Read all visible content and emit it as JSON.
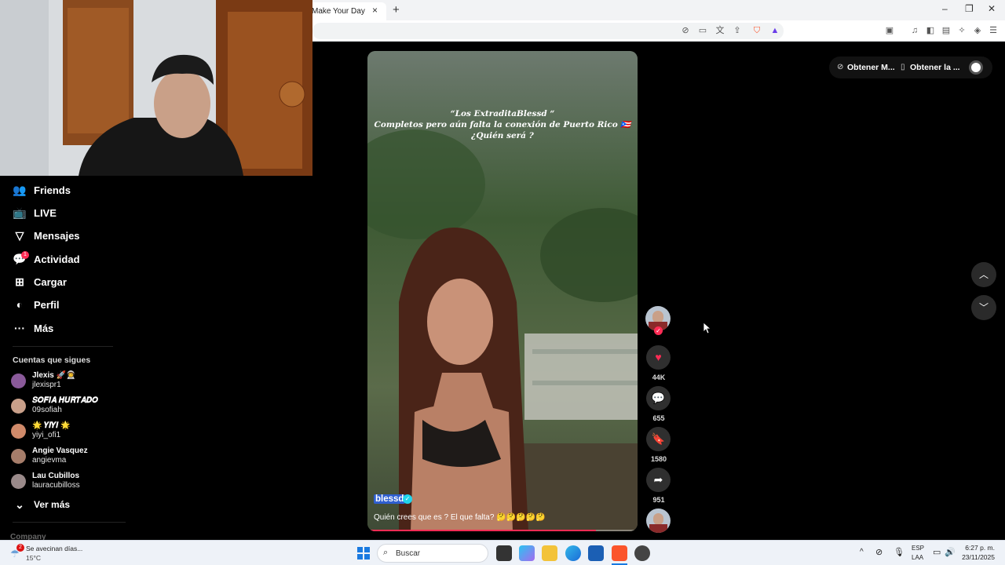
{
  "browser": {
    "tab_title": "Make Your Day",
    "tab_close": "×",
    "new_tab": "+",
    "window_controls": [
      "–",
      "❐",
      "✕"
    ]
  },
  "sidebar": {
    "nav": [
      {
        "label": "Friends",
        "icon": "friends-icon"
      },
      {
        "label": "LIVE",
        "icon": "live-icon"
      },
      {
        "label": "Mensajes",
        "icon": "messages-icon"
      },
      {
        "label": "Actividad",
        "icon": "activity-icon",
        "badge": "1"
      },
      {
        "label": "Cargar",
        "icon": "upload-icon"
      },
      {
        "label": "Perfil",
        "icon": "profile-icon"
      },
      {
        "label": "Más",
        "icon": "more-icon"
      }
    ],
    "following_title": "Cuentas que sigues",
    "accounts": [
      {
        "name": "Jlexis 🚀👨‍🚀",
        "user": "jlexispr1",
        "color": "#8a5a9a"
      },
      {
        "name": "𝑺𝑶𝑭𝑰𝑨 𝑯𝑼𝑹𝑻𝑨𝑫𝑶",
        "user": "09sofiah",
        "color": "#c9a08a"
      },
      {
        "name": "🌟 𝒀𝑰𝒀𝑰 🌟",
        "user": "yiyi_ofi1",
        "color": "#d08a6a"
      },
      {
        "name": "Angie Vasquez",
        "user": "angievma",
        "color": "#a67d6a"
      },
      {
        "name": "Lau Cubillos",
        "user": "lauracubilloss",
        "color": "#9a8a8a"
      }
    ],
    "see_more": "Ver más",
    "footer_partial": "Company"
  },
  "video": {
    "overlay_lines": [
      "“Los ExtraditaBlessd “",
      "Completos pero aún falta la conexión de Puerto Rico 🇵🇷",
      "¿Quién será ?"
    ],
    "author": "blessd",
    "caption": "Quién crees que es ? El que falta? 🤔🤔🤔🤔🤔",
    "progress": 0.85
  },
  "actions": {
    "likes": "44K",
    "comments": "655",
    "saves": "1580",
    "shares": "951"
  },
  "top_right": {
    "item1": "Obtener M...",
    "item2": "Obtener la ..."
  },
  "taskbar": {
    "weather_title": "Se avecinan días...",
    "weather_temp": "15°C",
    "weather_badge": "2",
    "search_placeholder": "Buscar",
    "lang_line1": "ESP",
    "lang_line2": "LAA",
    "time": "6:27 p. m.",
    "date": "23/11/2025"
  }
}
